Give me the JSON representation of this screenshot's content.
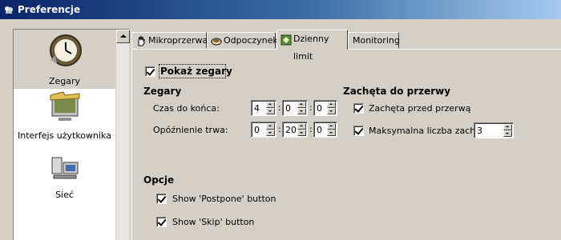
{
  "window": {
    "title": "Preferencje"
  },
  "sidebar": {
    "items": [
      {
        "label": "Zegary",
        "icon": "clock-icon",
        "selected": true
      },
      {
        "label": "Interfejs użytkownika",
        "icon": "interface-icon",
        "selected": false
      },
      {
        "label": "Sieć",
        "icon": "network-icon",
        "selected": false
      }
    ]
  },
  "tabs": [
    {
      "label": "Mikroprzerwa",
      "icon": "hand-icon",
      "active": false
    },
    {
      "label": "Odpoczynek",
      "icon": "cup-icon",
      "active": false
    },
    {
      "label": "Dzienny limit",
      "icon": "limit-icon",
      "active": true
    },
    {
      "label": "Monitoring",
      "icon": "",
      "active": false
    }
  ],
  "panel": {
    "show_clocks_label": "Pokaż zegary",
    "show_clocks_checked": true,
    "clocks": {
      "heading": "Zegary",
      "time_left_label": "Czas do końca:",
      "time_left": [
        "4",
        "0",
        "0"
      ],
      "postpone_label": "Opóźnienie trwa:",
      "postpone": [
        "0",
        "20",
        "0"
      ],
      "separator": ":"
    },
    "prompt": {
      "heading": "Zachęta do przerwy",
      "prompt_before_label": "Zachęta przed przerwą",
      "prompt_before_checked": true,
      "max_prompts_label": "Maksymalna liczba zachęt:",
      "max_prompts_checked": true,
      "max_prompts_value": "3"
    },
    "options": {
      "heading": "Opcje",
      "show_postpone_label": "Show 'Postpone' button",
      "show_postpone_checked": true,
      "show_skip_label": "Show 'Skip' button",
      "show_skip_checked": true
    }
  }
}
